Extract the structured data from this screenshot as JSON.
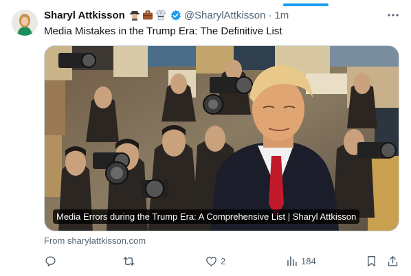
{
  "author": {
    "name": "Sharyl Attkisson",
    "handle": "@SharylAttkisson",
    "separator": "·",
    "time": "1m",
    "badge_emojis": [
      "detective-emoji",
      "briefcase-emoji",
      "judo-uniform-emoji"
    ],
    "verified": true
  },
  "tweet": {
    "text": "Media Mistakes in the Trump Era: The Definitive List"
  },
  "card": {
    "title": "Media Errors during the Trump Era: A Comprehensive List | Sharyl Attkisson",
    "source": "From sharylattkisson.com",
    "image": "collage-of-press-photographers-with-trump-portrait"
  },
  "actions": {
    "reply_count": "",
    "retweet_count": "",
    "like_count": "2",
    "view_count": "184"
  },
  "colors": {
    "accent": "#1d9bf0",
    "secondary_text": "#536471",
    "tie_red": "#c11a2b"
  }
}
